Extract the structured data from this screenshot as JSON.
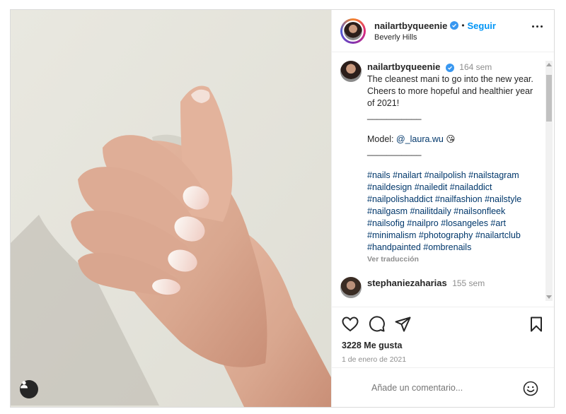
{
  "header": {
    "username": "nailartbyqueenie",
    "separator": "•",
    "follow_label": "Seguir",
    "location": "Beverly Hills"
  },
  "caption": {
    "username": "nailartbyqueenie",
    "age": "164 sem",
    "line1": "The cleanest mani to go into the new year. Cheers to more hopeful and healthier year of 2021!",
    "divider1": "___________",
    "model_label": "Model: ",
    "model_handle": "@_laura.wu",
    "model_emoji": "😘",
    "divider2": "___________",
    "hashtags": "#nails #nailart #nailpolish #nailstagram #naildesign #nailedit #nailaddict #nailpolishaddict #nailfashion #nailstyle #nailgasm #nailitdaily #nailsonfleek #nailsofig #nailpro #losangeles #art #minimalism #photography #nailartclub #handpainted #ombrenails",
    "translate_label": "Ver traducción"
  },
  "comment1": {
    "username": "stephaniezaharias",
    "age": "155 sem"
  },
  "post": {
    "likes": "3228 Me gusta",
    "date": "1 de enero de 2021"
  },
  "add_comment": {
    "placeholder": "Añade un comentario..."
  },
  "colors": {
    "accent": "#0095f6",
    "verified": "#3897f0",
    "hashtag": "#00376b"
  }
}
